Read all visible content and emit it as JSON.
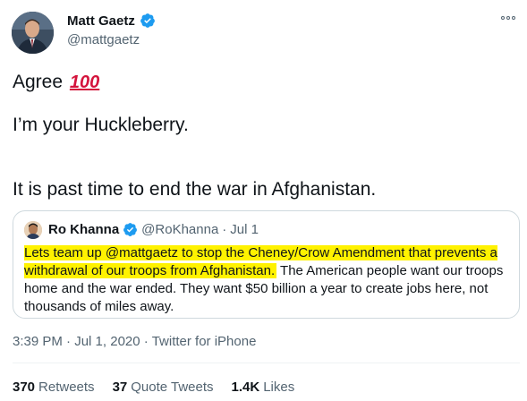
{
  "author": {
    "display_name": "Matt Gaetz",
    "handle": "@mattgaetz",
    "verified_icon": "verified-badge-icon"
  },
  "tweet": {
    "line1_text": "Agree",
    "line1_emoji": "100",
    "line2_text": "I’m your Huckleberry.",
    "line3_text": "It is past time to end the war in Afghanistan."
  },
  "quoted_tweet": {
    "display_name": "Ro Khanna",
    "handle": "@RoKhanna",
    "separator": "·",
    "date": "Jul 1",
    "text_highlighted": "Lets team up @mattgaetz to stop the Cheney/Crow Amendment that prevents a withdrawal of our troops from Afghanistan.",
    "text_rest": " The American people want our troops home and the war ended. They want $50 billion a year to create jobs here, not thousands of miles away."
  },
  "meta": {
    "time": "3:39 PM",
    "separator1": "·",
    "date": "Jul 1, 2020",
    "separator2": "·",
    "source": "Twitter for iPhone"
  },
  "stats": {
    "retweets_count": "370",
    "retweets_label": "Retweets",
    "quote_count": "37",
    "quote_label": "Quote Tweets",
    "likes_count": "1.4K",
    "likes_label": "Likes"
  },
  "colors": {
    "highlight": "#fff200",
    "verified": "#1d9bf0",
    "secondary_text": "#536471"
  }
}
